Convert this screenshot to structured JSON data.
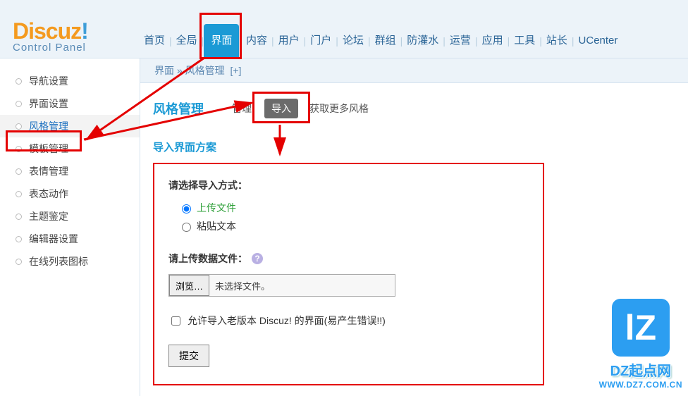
{
  "logo": {
    "name": "Discuz",
    "bang": "!",
    "sub": "Control Panel"
  },
  "nav": {
    "items": [
      "首页",
      "全局",
      "界面",
      "内容",
      "用户",
      "门户",
      "论坛",
      "群组",
      "防灌水",
      "运营",
      "应用",
      "工具",
      "站长",
      "UCenter"
    ],
    "active_index": 2
  },
  "sidebar": {
    "items": [
      "导航设置",
      "界面设置",
      "风格管理",
      "模板管理",
      "表情管理",
      "表态动作",
      "主题鉴定",
      "编辑器设置",
      "在线列表图标"
    ],
    "active_index": 2
  },
  "breadcrumb": {
    "a": "界面",
    "sep": "»",
    "b": "风格管理",
    "plus": "[+]"
  },
  "pagehead": {
    "title": "风格管理",
    "manage": "管理",
    "import": "导入",
    "more": "获取更多风格"
  },
  "subtitle": "导入界面方案",
  "form": {
    "choose_label": "请选择导入方式：",
    "opt_upload": "上传文件",
    "opt_paste": "粘贴文本",
    "upload_label": "请上传数据文件：",
    "browse": "浏览…",
    "no_file": "未选择文件。",
    "allow_old": "允许导入老版本 Discuz! 的界面(易产生错误!!)",
    "submit": "提交"
  },
  "watermark": {
    "logo": "lZ",
    "t1": "DZ起点网",
    "t2": "WWW.DZ7.COM.CN"
  }
}
